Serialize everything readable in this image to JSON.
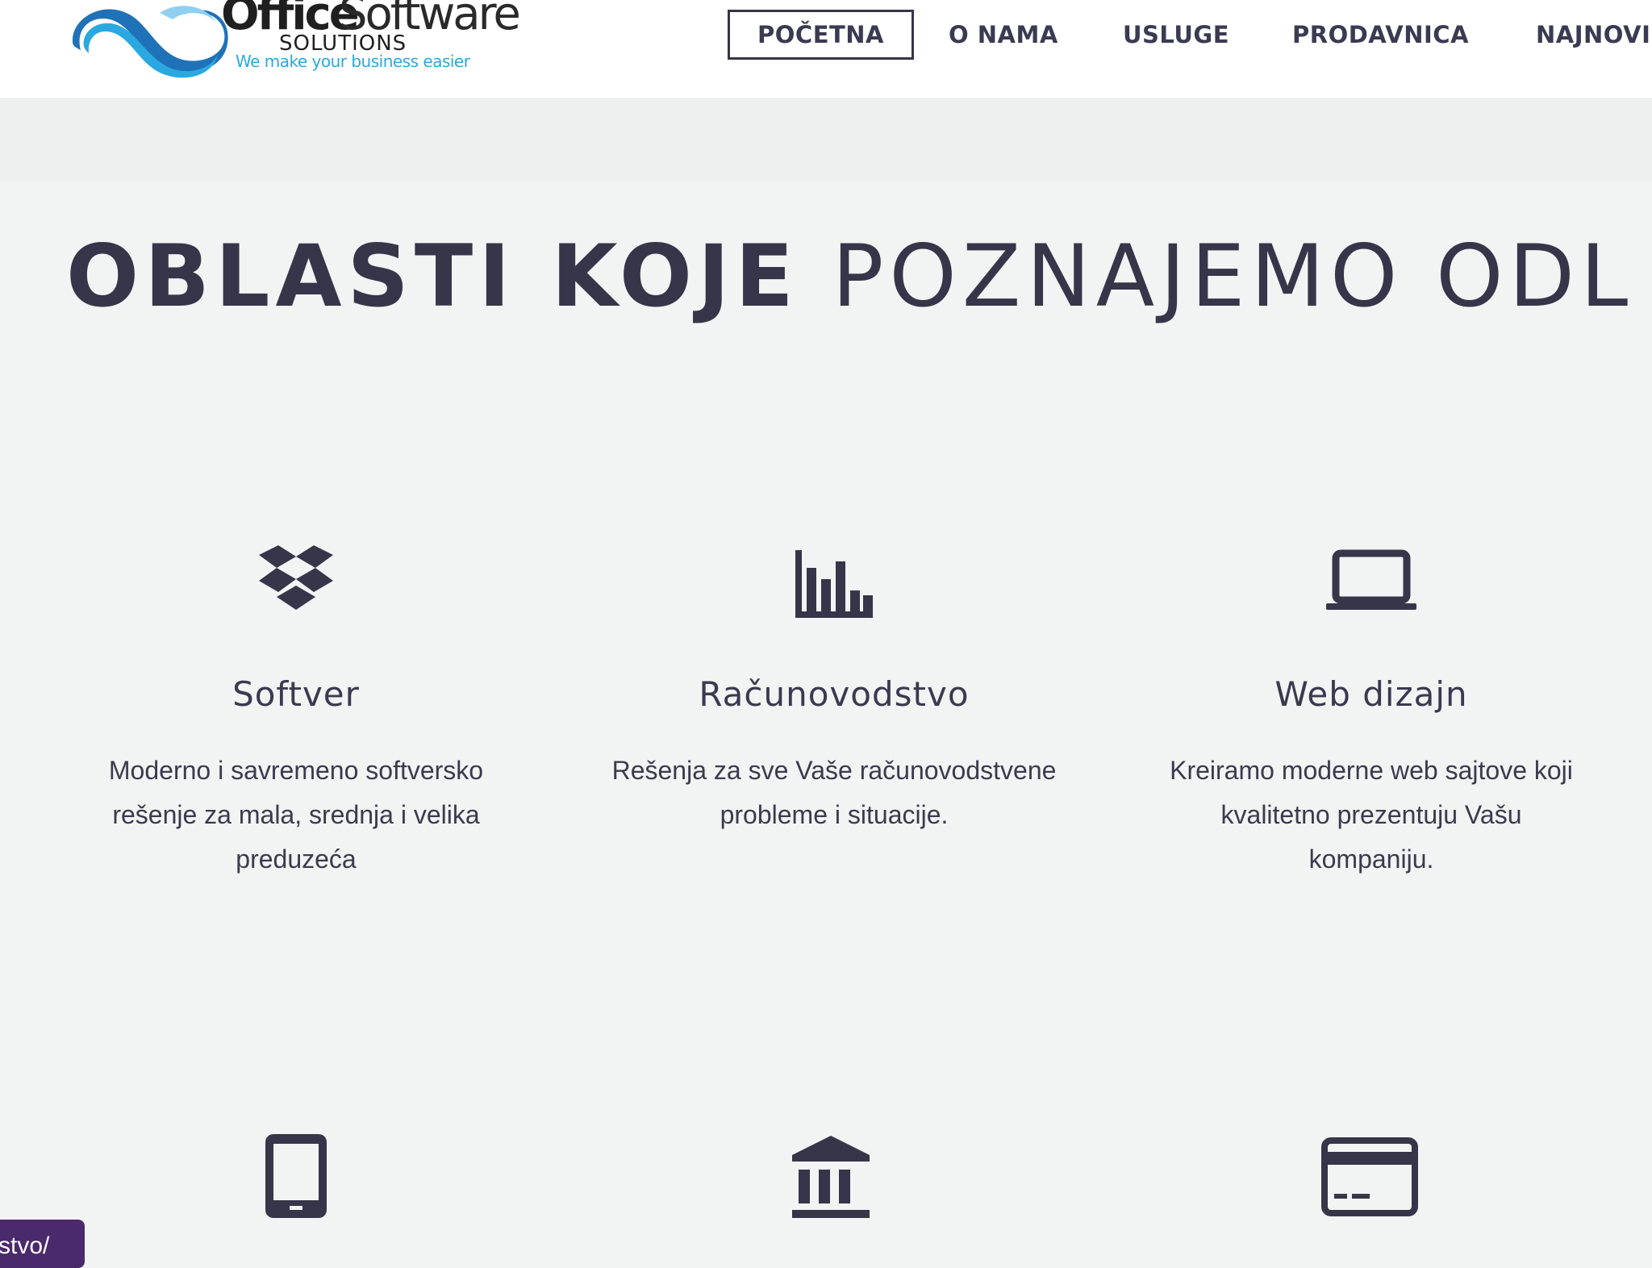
{
  "header": {
    "logo": {
      "brand_office": "Office",
      "brand_software": "Software",
      "brand_solutions": "SOLUTIONS",
      "tagline": "We make your business easier"
    },
    "nav": [
      {
        "label": "POČETNA",
        "active": true
      },
      {
        "label": "O NAMA",
        "active": false
      },
      {
        "label": "USLUGE",
        "active": false
      },
      {
        "label": "PRODAVNICA",
        "active": false
      },
      {
        "label": "NAJNOVI",
        "active": false
      }
    ]
  },
  "section": {
    "title_bold": "OBLASTI KOJE",
    "title_light": "POZNAJEMO ODL"
  },
  "features": [
    {
      "icon": "dropbox-icon",
      "title": "Softver",
      "desc_lines": [
        "Moderno i savremeno softversko",
        "rešenje za mala, srednja i velika",
        "preduzeća"
      ]
    },
    {
      "icon": "bar-chart-icon",
      "title": "Računovodstvo",
      "desc_lines": [
        "Rešenja za sve Vaše računovodstvene",
        "probleme i situacije."
      ]
    },
    {
      "icon": "laptop-icon",
      "title": "Web dizajn",
      "desc_lines": [
        "Kreiramo moderne web sajtove koji",
        "kvalitetno prezentuju Vašu",
        "kompaniju."
      ]
    }
  ],
  "features_row2": [
    {
      "icon": "tablet-icon"
    },
    {
      "icon": "bank-icon"
    },
    {
      "icon": "credit-card-icon"
    }
  ],
  "corner_tag": {
    "text": "stvo/"
  },
  "colors": {
    "text_dark": "#363549",
    "background": "#f2f3f3",
    "logo_blue": "#29a9e0",
    "tag_purple": "#4a2a6a"
  }
}
